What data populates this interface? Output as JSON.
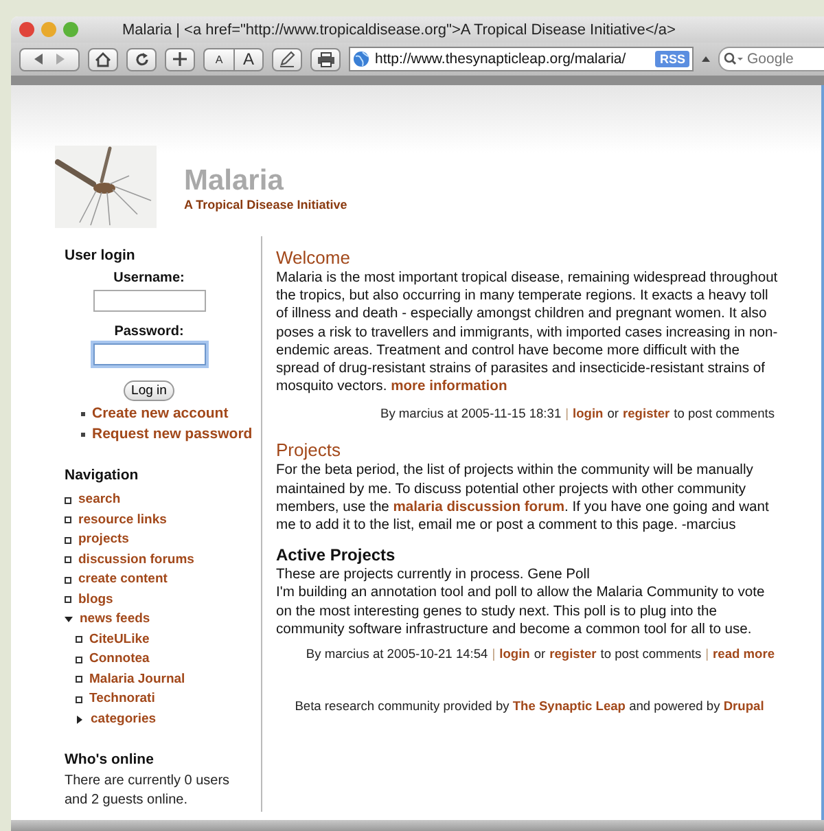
{
  "window": {
    "title": "Malaria | <a href=\"http://www.tropicaldisease.org\">A Tropical Disease Initiative</a>"
  },
  "toolbar": {
    "text_smaller": "A",
    "text_bigger": "A",
    "url": "http://www.thesynapticleap.org/malaria/",
    "rss": "RSS",
    "search": {
      "placeholder": "Google"
    }
  },
  "site": {
    "name": "Malaria",
    "slogan": "A Tropical Disease Initiative"
  },
  "login": {
    "title": "User login",
    "fields": [
      {
        "label": "Username:",
        "focused": false
      },
      {
        "label": "Password:",
        "focused": true
      }
    ],
    "button": "Log in",
    "links": [
      "Create new account",
      "Request new password"
    ]
  },
  "navigation": {
    "title": "Navigation",
    "items": [
      {
        "label": "search",
        "kind": "link"
      },
      {
        "label": "resource links",
        "kind": "link"
      },
      {
        "label": "projects",
        "kind": "link"
      },
      {
        "label": "discussion forums",
        "kind": "link"
      },
      {
        "label": "create content",
        "kind": "link"
      },
      {
        "label": "blogs",
        "kind": "link"
      },
      {
        "label": "news feeds",
        "kind": "folder",
        "expanded": true,
        "children": [
          {
            "label": "CiteULike",
            "kind": "link"
          },
          {
            "label": "Connotea",
            "kind": "link"
          },
          {
            "label": "Malaria Journal",
            "kind": "link"
          },
          {
            "label": "Technorati",
            "kind": "link"
          },
          {
            "label": "categories",
            "kind": "folder",
            "expanded": false
          }
        ]
      }
    ]
  },
  "online": {
    "title": "Who's online",
    "text": "There are currently 0 users and 2 guests online."
  },
  "posts": [
    {
      "title": "Welcome",
      "body": [
        [
          {
            "text": "Malaria is the most important tropical disease, remaining widespread throughout the tropics, but also occurring in many temperate regions. It exacts a heavy toll of illness and death - especially amongst children and pregnant women. It also poses a risk to travellers and immigrants, with imported cases increasing in non-endemic areas. Treatment and control have become more difficult with the spread of drug-resistant strains of parasites and insecticide-resistant strains of mosquito vectors. ",
            "kind": "text"
          },
          {
            "text": "more information",
            "kind": "link"
          }
        ]
      ],
      "meta": [
        {
          "text": "By marcius at 2005-11-15 18:31",
          "kind": "text"
        },
        {
          "text": "|",
          "kind": "separator"
        },
        {
          "text": "login",
          "kind": "link"
        },
        {
          "text": "or",
          "kind": "text"
        },
        {
          "text": "register",
          "kind": "link"
        },
        {
          "text": "to post comments",
          "kind": "text"
        }
      ]
    },
    {
      "title": "Projects",
      "body": [
        [
          {
            "text": "For the beta period, the list of projects within the community will be manually maintained by me. To discuss potential other projects with other community members, use the ",
            "kind": "text"
          },
          {
            "text": "malaria discussion forum",
            "kind": "link"
          },
          {
            "text": ". If you have one going and want me to add it to the list, email me or post a comment to this page. -marcius",
            "kind": "text"
          }
        ]
      ],
      "subheading": "Active Projects",
      "sub_body": [
        "These are projects currently in process. Gene Poll",
        "I'm building an annotation tool and poll to allow the Malaria Community to vote on the most interesting genes to study next. This poll is to plug into the community software infrastructure and become a common tool for all to use."
      ],
      "meta": [
        {
          "text": "By marcius at 2005-10-21 14:54",
          "kind": "text"
        },
        {
          "text": "|",
          "kind": "separator"
        },
        {
          "text": "login",
          "kind": "link"
        },
        {
          "text": "or",
          "kind": "text"
        },
        {
          "text": "register",
          "kind": "link"
        },
        {
          "text": "to post comments",
          "kind": "text"
        },
        {
          "text": "|",
          "kind": "separator"
        },
        {
          "text": "read more",
          "kind": "link"
        }
      ]
    }
  ],
  "footer": [
    {
      "text": "Beta research community provided by ",
      "kind": "text"
    },
    {
      "text": "The Synaptic Leap",
      "kind": "link"
    },
    {
      "text": " and powered by ",
      "kind": "text"
    },
    {
      "text": "Drupal",
      "kind": "link"
    }
  ]
}
